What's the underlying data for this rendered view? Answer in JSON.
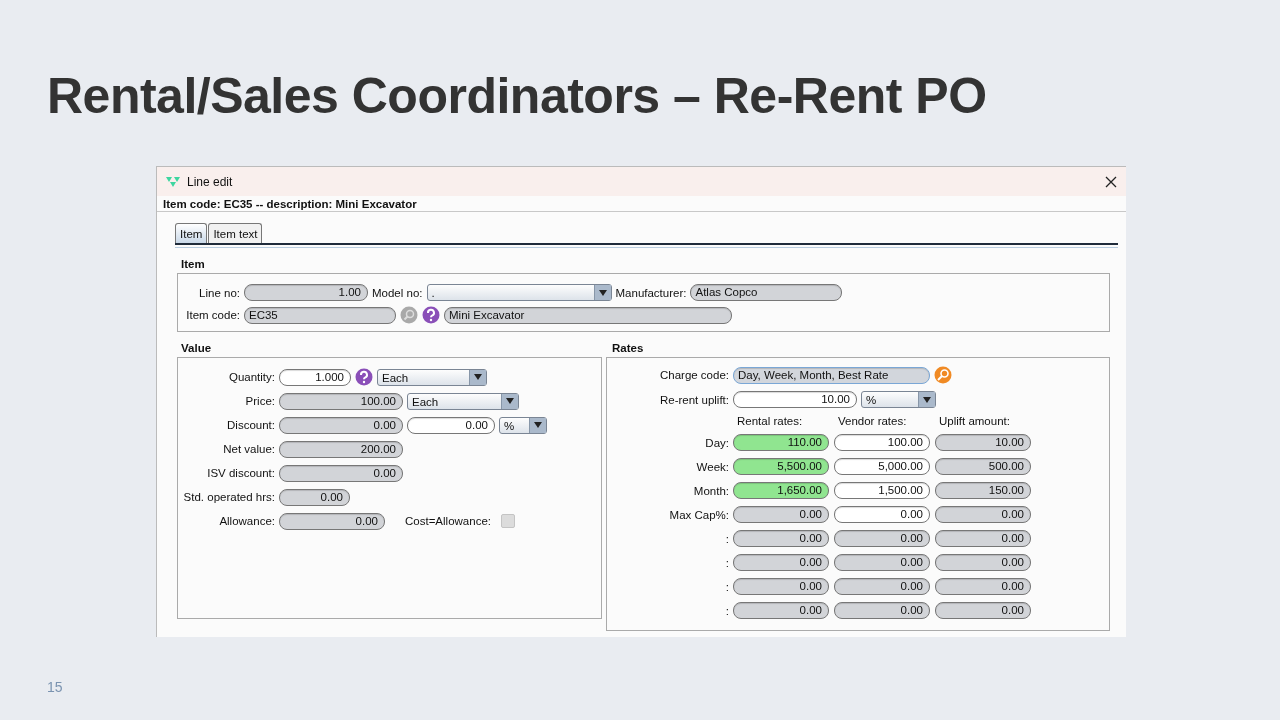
{
  "slide": {
    "title": "Rental/Sales Coordinators – Re-Rent PO",
    "page_number": "15"
  },
  "window": {
    "title": "Line edit",
    "header": "Item code: EC35 -- description: Mini Excavator"
  },
  "tabs": [
    {
      "label": "Item",
      "selected": true
    },
    {
      "label": "Item text",
      "selected": false
    }
  ],
  "item_section": {
    "title": "Item",
    "rows": [
      {
        "controls": [
          {
            "kind": "label",
            "text": "Line no:"
          },
          {
            "kind": "readonly",
            "value": "1.00"
          },
          {
            "kind": "label",
            "text": "Model no:"
          },
          {
            "kind": "dropdown",
            "value": "."
          },
          {
            "kind": "label",
            "text": "Manufacturer:"
          },
          {
            "kind": "readonly",
            "value": "Atlas Copco"
          }
        ]
      },
      {
        "controls": [
          {
            "kind": "label",
            "text": "Item code:"
          },
          {
            "kind": "readonly",
            "value": "EC35"
          },
          {
            "kind": "search"
          },
          {
            "kind": "help"
          },
          {
            "kind": "readonly",
            "value": "Mini Excavator"
          }
        ]
      }
    ]
  },
  "value_section": {
    "title": "Value",
    "rows": [
      {
        "label": "Quantity:",
        "controls": [
          {
            "kind": "editable",
            "value": "1.000"
          },
          {
            "kind": "help"
          },
          {
            "kind": "dropdown",
            "value": "Each"
          }
        ]
      },
      {
        "label": "Price:",
        "controls": [
          {
            "kind": "readonly",
            "value": "100.00"
          },
          {
            "kind": "dropdown",
            "value": "Each"
          }
        ]
      },
      {
        "label": "Discount:",
        "controls": [
          {
            "kind": "readonly",
            "value": "0.00"
          },
          {
            "kind": "editable",
            "value": "0.00"
          },
          {
            "kind": "dropdown",
            "value": "%"
          }
        ]
      },
      {
        "label": "Net value:",
        "controls": [
          {
            "kind": "readonly",
            "value": "200.00"
          }
        ]
      },
      {
        "label": "ISV discount:",
        "controls": [
          {
            "kind": "readonly",
            "value": "0.00"
          }
        ]
      },
      {
        "label": "Std. operated hrs:",
        "controls": [
          {
            "kind": "readonly",
            "value": "0.00"
          }
        ]
      },
      {
        "label": "Allowance:",
        "controls": [
          {
            "kind": "readonly",
            "value": "0.00"
          },
          {
            "kind": "label",
            "text": "Cost=Allowance:"
          },
          {
            "kind": "checkbox",
            "checked": false
          }
        ]
      }
    ]
  },
  "rates_section": {
    "title": "Rates",
    "charge_code": {
      "label": "Charge code:",
      "value": "Day, Week, Month, Best Rate"
    },
    "uplift": {
      "label": "Re-rent uplift:",
      "value": "10.00",
      "unit": "%"
    },
    "columns": [
      "Rental rates:",
      "Vendor rates:",
      "Uplift amount:"
    ],
    "rows": [
      {
        "label": "Day:",
        "cells": [
          {
            "kind": "highlight",
            "value": "110.00"
          },
          {
            "kind": "editable",
            "value": "100.00"
          },
          {
            "kind": "readonly",
            "value": "10.00"
          }
        ]
      },
      {
        "label": "Week:",
        "cells": [
          {
            "kind": "highlight",
            "value": "5,500.00"
          },
          {
            "kind": "editable",
            "value": "5,000.00"
          },
          {
            "kind": "readonly",
            "value": "500.00"
          }
        ]
      },
      {
        "label": "Month:",
        "cells": [
          {
            "kind": "highlight",
            "value": "1,650.00"
          },
          {
            "kind": "editable",
            "value": "1,500.00"
          },
          {
            "kind": "readonly",
            "value": "150.00"
          }
        ]
      },
      {
        "label": "Max Cap%:",
        "cells": [
          {
            "kind": "readonly",
            "value": "0.00"
          },
          {
            "kind": "editable",
            "value": "0.00"
          },
          {
            "kind": "readonly",
            "value": "0.00"
          }
        ]
      },
      {
        "label": ":",
        "cells": [
          {
            "kind": "readonly",
            "value": "0.00"
          },
          {
            "kind": "readonly",
            "value": "0.00"
          },
          {
            "kind": "readonly",
            "value": "0.00"
          }
        ]
      },
      {
        "label": ":",
        "cells": [
          {
            "kind": "readonly",
            "value": "0.00"
          },
          {
            "kind": "readonly",
            "value": "0.00"
          },
          {
            "kind": "readonly",
            "value": "0.00"
          }
        ]
      },
      {
        "label": ":",
        "cells": [
          {
            "kind": "readonly",
            "value": "0.00"
          },
          {
            "kind": "readonly",
            "value": "0.00"
          },
          {
            "kind": "readonly",
            "value": "0.00"
          }
        ]
      },
      {
        "label": ":",
        "cells": [
          {
            "kind": "readonly",
            "value": "0.00"
          },
          {
            "kind": "readonly",
            "value": "0.00"
          },
          {
            "kind": "readonly",
            "value": "0.00"
          }
        ]
      }
    ]
  }
}
